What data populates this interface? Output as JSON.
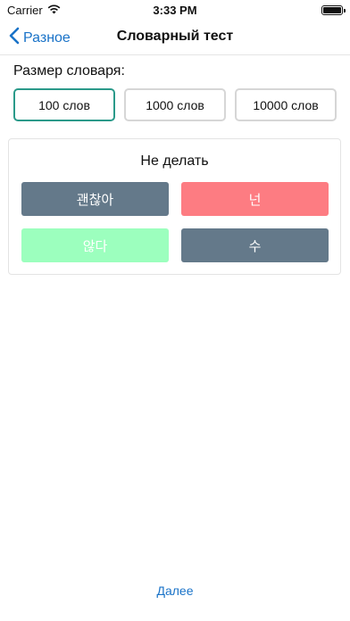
{
  "status": {
    "carrier": "Carrier",
    "time": "3:33 PM"
  },
  "nav": {
    "back_label": "Разное",
    "title": "Словарный тест"
  },
  "size": {
    "label": "Размер словаря:",
    "options": [
      "100 слов",
      "1000 слов",
      "10000 слов"
    ],
    "selected": "100 слов"
  },
  "test": {
    "prompt": "Не делать",
    "answers": [
      {
        "label": "괜찮아",
        "color": "#64798a"
      },
      {
        "label": "넌",
        "color": "#fd7c82"
      },
      {
        "label": "않다",
        "color": "#9cffbe"
      },
      {
        "label": "수",
        "color": "#64798a"
      }
    ]
  },
  "footer": {
    "next_label": "Далее"
  },
  "colors": {
    "accent": "#1a73c8",
    "selected_border": "#2b9a8a"
  }
}
